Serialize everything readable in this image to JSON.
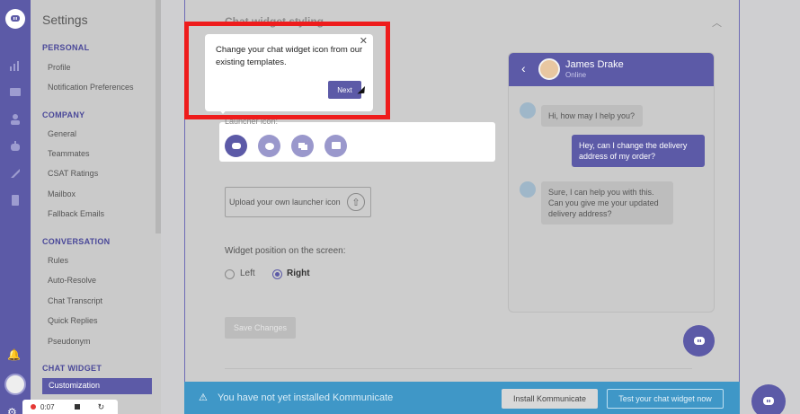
{
  "sidebar": {
    "title": "Settings",
    "sections": [
      {
        "label": "PERSONAL",
        "items": [
          "Profile",
          "Notification Preferences"
        ]
      },
      {
        "label": "COMPANY",
        "items": [
          "General",
          "Teammates",
          "CSAT Ratings",
          "Mailbox",
          "Fallback Emails"
        ]
      },
      {
        "label": "CONVERSATION",
        "items": [
          "Rules",
          "Auto-Resolve",
          "Chat Transcript",
          "Quick Replies",
          "Pseudonym"
        ]
      },
      {
        "label": "CHAT WIDGET",
        "items": [
          "Customization"
        ]
      }
    ]
  },
  "main": {
    "title": "Chat widget styling",
    "subtitle": "",
    "launcher_label": "Launcher icon:",
    "upload_label": "Upload your own launcher icon",
    "position_label": "Widget position on the screen:",
    "position_options": [
      "Left",
      "Right"
    ],
    "position_selected": "Right",
    "save_label": "Save Changes"
  },
  "preview": {
    "agent_name": "James Drake",
    "agent_status": "Online",
    "messages": [
      {
        "from": "agent",
        "text": "Hi, how may I help you?"
      },
      {
        "from": "user",
        "text": "Hey, can I change the delivery address of my order?"
      },
      {
        "from": "agent",
        "text": "Sure, I can help you with this. Can you give me your updated delivery address?"
      }
    ]
  },
  "banner": {
    "message": "You have not yet installed Kommunicate",
    "install_label": "Install Kommunicate",
    "test_label": "Test your chat widget now"
  },
  "tooltip": {
    "text": "Change your chat widget icon from our existing templates.",
    "next_label": "Next",
    "close_glyph": "✕"
  },
  "recorder": {
    "time": "0:07"
  },
  "colors": {
    "accent": "#5c5aa7",
    "banner": "#3f97c7",
    "highlight": "#ee1c1c"
  },
  "icons": [
    "logo-icon",
    "reports-icon",
    "conversations-icon",
    "users-icon",
    "bot-icon",
    "integrations-icon",
    "docs-icon",
    "bell-icon",
    "gear-icon",
    "chevron-up-icon",
    "back-icon",
    "upload-icon",
    "warning-icon"
  ]
}
